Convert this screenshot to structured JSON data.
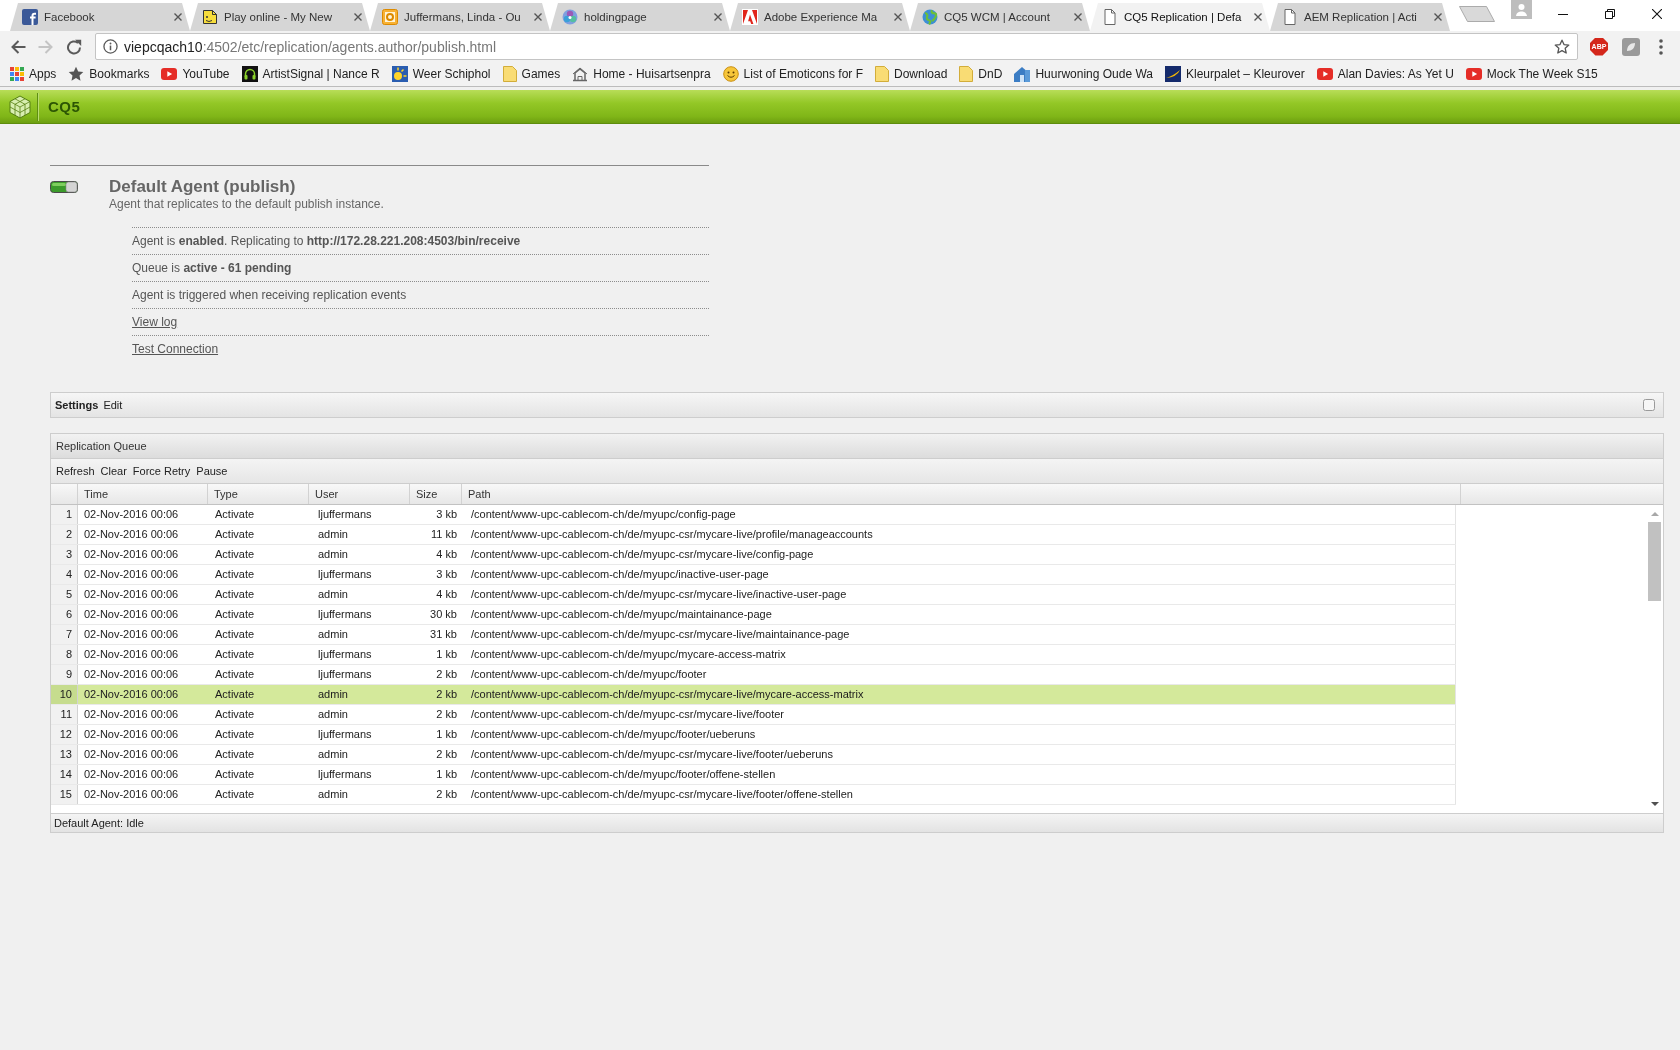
{
  "browser": {
    "tabs": [
      {
        "title": "Facebook",
        "kind": "hook-tile",
        "selected": false
      },
      {
        "title": "Play online - My New",
        "kind": "note",
        "selected": false
      },
      {
        "title": "Juffermans, Linda - Ou",
        "kind": "ring-tile",
        "selected": false
      },
      {
        "title": "holdingpage",
        "kind": "flower",
        "selected": false
      },
      {
        "title": "Adobe Experience Ma",
        "kind": "triangle-tile",
        "selected": false
      },
      {
        "title": "CQ5 WCM | Account",
        "kind": "globe",
        "selected": false
      },
      {
        "title": "CQ5 Replication | Defa",
        "kind": "page",
        "selected": true
      },
      {
        "title": "AEM Replication | Acti",
        "kind": "page",
        "selected": false
      }
    ],
    "nav_buttons": [
      {
        "kind": "back",
        "disabled": false
      },
      {
        "kind": "forward",
        "disabled": true
      },
      {
        "kind": "reload",
        "disabled": false
      }
    ],
    "address": {
      "host": "viepcqach10",
      "path": ":4502/etc/replication/agents.author/publish.html"
    },
    "extensions": [
      {
        "kind": "octagon",
        "label": "ABP"
      },
      {
        "kind": "tile"
      }
    ],
    "bookmarks": [
      {
        "kind": "grid",
        "label": "Apps"
      },
      {
        "kind": "star",
        "label": "Bookmarks"
      },
      {
        "kind": "play",
        "label": "YouTube"
      },
      {
        "kind": "headphones",
        "label": "ArtistSignal | Nance R"
      },
      {
        "kind": "sun",
        "label": "Weer Schiphol"
      },
      {
        "kind": "folder",
        "label": "Games"
      },
      {
        "kind": "house-outline",
        "label": "Home - Huisartsenpra"
      },
      {
        "kind": "smiley",
        "label": "List of Emoticons for F"
      },
      {
        "kind": "folder",
        "label": "Download"
      },
      {
        "kind": "folder",
        "label": "DnD"
      },
      {
        "kind": "house",
        "label": "Huurwoning Oude Wa"
      },
      {
        "kind": "swoosh",
        "label": "Kleurpalet – Kleurover"
      },
      {
        "kind": "play",
        "label": "Alan Davies: As Yet U"
      },
      {
        "kind": "play",
        "label": "Mock The Week S15"
      }
    ]
  },
  "header": {
    "title": "CQ5"
  },
  "agent": {
    "enabled": true,
    "title": "Default Agent (publish)",
    "description": "Agent that replicates to the default publish instance.",
    "details": [
      {
        "kind": "text",
        "text": "Agent is **enabled**. Replicating to **http://172.28.221.208:4503/bin/receive**"
      },
      {
        "kind": "text",
        "text": "Queue is **active - 61 pending**"
      },
      {
        "kind": "text",
        "text": "Agent is triggered when receiving replication events"
      },
      {
        "kind": "link",
        "text": "View log"
      },
      {
        "kind": "link",
        "text": "Test Connection"
      }
    ]
  },
  "settings_panel": {
    "title": "Settings",
    "actions": [
      "Edit"
    ]
  },
  "queue": {
    "title": "Replication Queue",
    "toolbar": [
      "Refresh",
      "Clear",
      "Force Retry",
      "Pause"
    ],
    "columns": [
      "Time",
      "Type",
      "User",
      "Size",
      "Path"
    ],
    "rows": [
      {
        "number": "1",
        "time": "02-Nov-2016 00:06",
        "type": "Activate",
        "user": "ljuffermans",
        "size": "3 kb",
        "path": "/content/www-upc-cablecom-ch/de/myupc/config-page",
        "selected": false
      },
      {
        "number": "2",
        "time": "02-Nov-2016 00:06",
        "type": "Activate",
        "user": "admin",
        "size": "11 kb",
        "path": "/content/www-upc-cablecom-ch/de/myupc-csr/mycare-live/profile/manageaccounts",
        "selected": false
      },
      {
        "number": "3",
        "time": "02-Nov-2016 00:06",
        "type": "Activate",
        "user": "admin",
        "size": "4 kb",
        "path": "/content/www-upc-cablecom-ch/de/myupc-csr/mycare-live/config-page",
        "selected": false
      },
      {
        "number": "4",
        "time": "02-Nov-2016 00:06",
        "type": "Activate",
        "user": "ljuffermans",
        "size": "3 kb",
        "path": "/content/www-upc-cablecom-ch/de/myupc/inactive-user-page",
        "selected": false
      },
      {
        "number": "5",
        "time": "02-Nov-2016 00:06",
        "type": "Activate",
        "user": "admin",
        "size": "4 kb",
        "path": "/content/www-upc-cablecom-ch/de/myupc-csr/mycare-live/inactive-user-page",
        "selected": false
      },
      {
        "number": "6",
        "time": "02-Nov-2016 00:06",
        "type": "Activate",
        "user": "ljuffermans",
        "size": "30 kb",
        "path": "/content/www-upc-cablecom-ch/de/myupc/maintainance-page",
        "selected": false
      },
      {
        "number": "7",
        "time": "02-Nov-2016 00:06",
        "type": "Activate",
        "user": "admin",
        "size": "31 kb",
        "path": "/content/www-upc-cablecom-ch/de/myupc-csr/mycare-live/maintainance-page",
        "selected": false
      },
      {
        "number": "8",
        "time": "02-Nov-2016 00:06",
        "type": "Activate",
        "user": "ljuffermans",
        "size": "1 kb",
        "path": "/content/www-upc-cablecom-ch/de/myupc/mycare-access-matrix",
        "selected": false
      },
      {
        "number": "9",
        "time": "02-Nov-2016 00:06",
        "type": "Activate",
        "user": "ljuffermans",
        "size": "2 kb",
        "path": "/content/www-upc-cablecom-ch/de/myupc/footer",
        "selected": false
      },
      {
        "number": "10",
        "time": "02-Nov-2016 00:06",
        "type": "Activate",
        "user": "admin",
        "size": "2 kb",
        "path": "/content/www-upc-cablecom-ch/de/myupc-csr/mycare-live/mycare-access-matrix",
        "selected": true
      },
      {
        "number": "11",
        "time": "02-Nov-2016 00:06",
        "type": "Activate",
        "user": "admin",
        "size": "2 kb",
        "path": "/content/www-upc-cablecom-ch/de/myupc-csr/mycare-live/footer",
        "selected": false
      },
      {
        "number": "12",
        "time": "02-Nov-2016 00:06",
        "type": "Activate",
        "user": "ljuffermans",
        "size": "1 kb",
        "path": "/content/www-upc-cablecom-ch/de/myupc/footer/ueberuns",
        "selected": false
      },
      {
        "number": "13",
        "time": "02-Nov-2016 00:06",
        "type": "Activate",
        "user": "admin",
        "size": "2 kb",
        "path": "/content/www-upc-cablecom-ch/de/myupc-csr/mycare-live/footer/ueberuns",
        "selected": false
      },
      {
        "number": "14",
        "time": "02-Nov-2016 00:06",
        "type": "Activate",
        "user": "ljuffermans",
        "size": "1 kb",
        "path": "/content/www-upc-cablecom-ch/de/myupc/footer/offene-stellen",
        "selected": false
      },
      {
        "number": "15",
        "time": "02-Nov-2016 00:06",
        "type": "Activate",
        "user": "admin",
        "size": "2 kb",
        "path": "/content/www-upc-cablecom-ch/de/myupc-csr/mycare-live/footer/offene-stellen",
        "selected": false
      }
    ],
    "status": "Default Agent: Idle"
  }
}
